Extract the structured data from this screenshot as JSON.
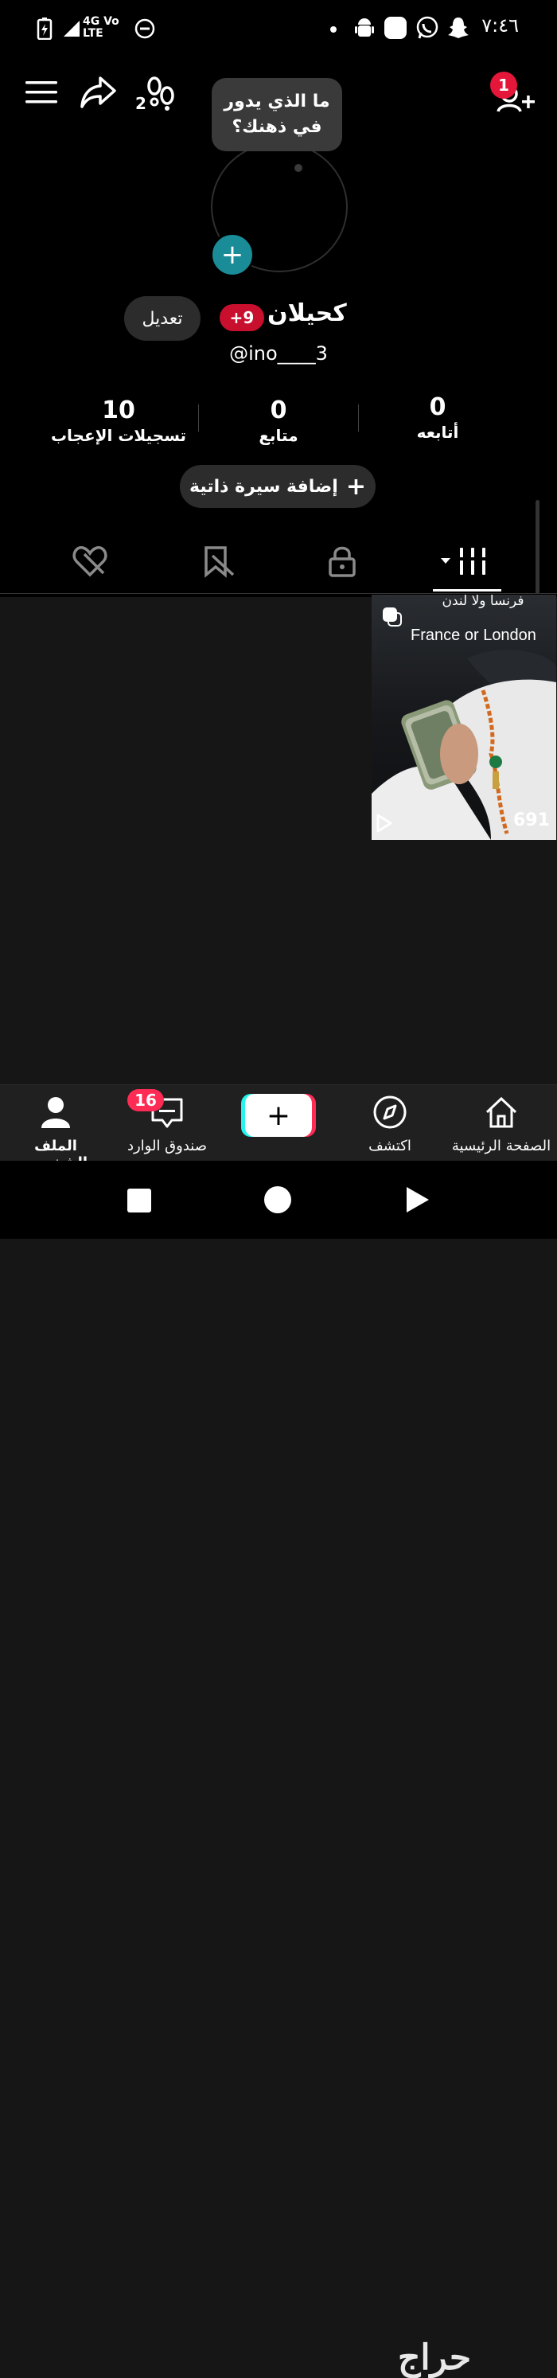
{
  "status_bar": {
    "time": "٧:٤٦",
    "network": "4G Vo LTE"
  },
  "header": {
    "friends_count": "2",
    "requests_badge": "1"
  },
  "profile": {
    "bubble_text": "ما الذي يدور في ذهنك؟",
    "name": "كحيلان",
    "badge": "+9",
    "edit_label": "تعديل",
    "handle": "@ino____3",
    "bio_button": "إضافة سيرة ذاتية",
    "stats": [
      {
        "num": "0",
        "label": "أتابعه"
      },
      {
        "num": "0",
        "label": "متابع"
      },
      {
        "num": "10",
        "label": "تسجيلات الإعجاب"
      }
    ]
  },
  "video": {
    "caption_ar": "فرنسا ولا لندن",
    "caption_en": "France or London",
    "views": "691"
  },
  "bottom_nav": {
    "home": "الصفحة الرئيسية",
    "discover": "اكتشف",
    "inbox": "صندوق الوارد",
    "inbox_badge": "16",
    "profile": "الملف الشخصي"
  },
  "watermark": "حراج"
}
